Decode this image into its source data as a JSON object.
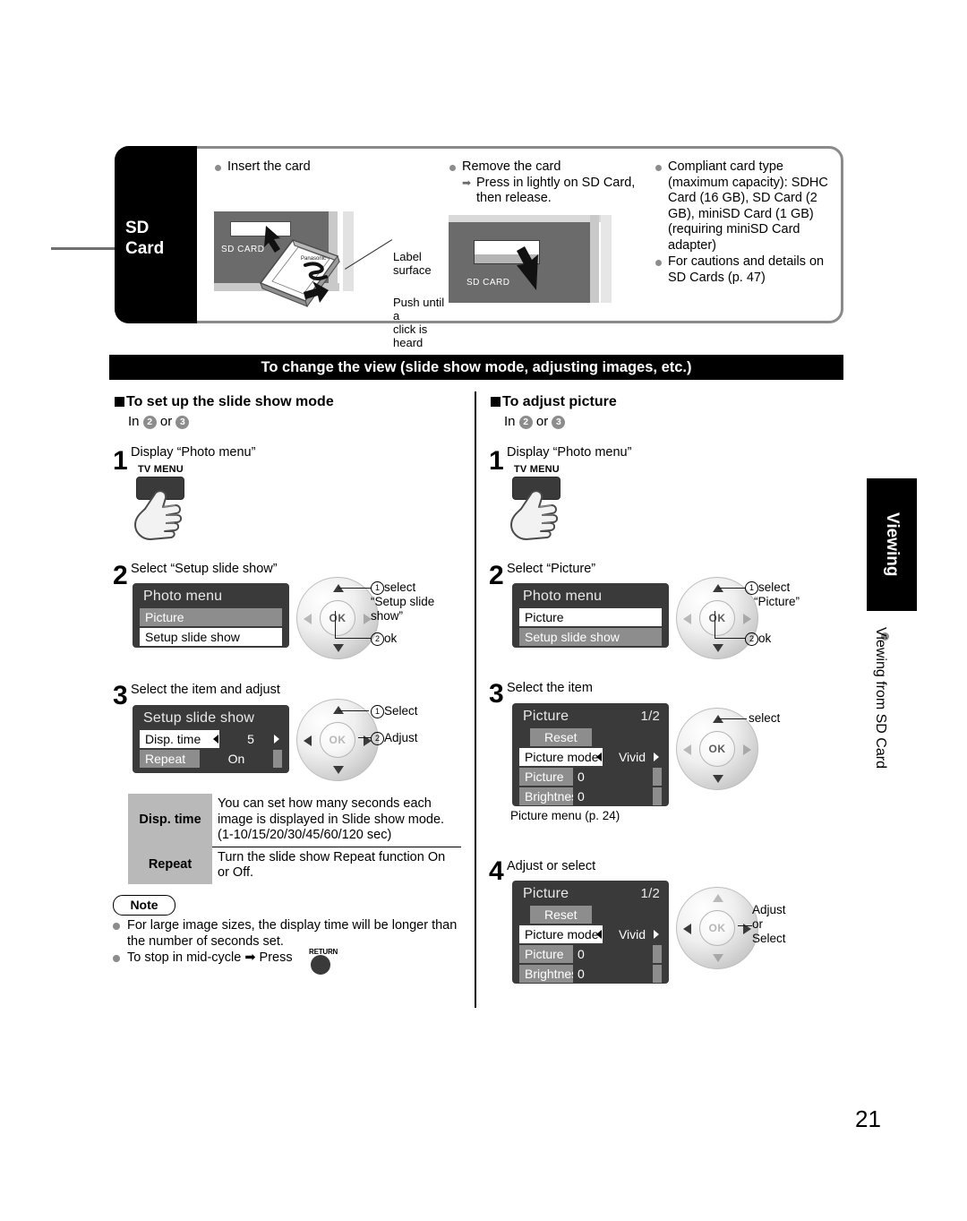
{
  "sd_box": {
    "tab_label_line1": "SD",
    "tab_label_line2": "Card",
    "insert": {
      "heading": "Insert the card",
      "callout_label": "Label\nsurface",
      "callout_push": "Push until a\nclick is heard",
      "slot_text": "SD CARD"
    },
    "remove": {
      "heading": "Remove the card",
      "detail": "Press in lightly on SD Card, then release.",
      "slot_text": "SD CARD"
    },
    "compliant": {
      "heading": "Compliant card type (maximum capacity): SDHC Card (16 GB), SD Card (2 GB), miniSD Card (1 GB) (requiring miniSD Card adapter)",
      "second": "For cautions and details on SD Cards (p. 47)"
    }
  },
  "banner": {
    "title": "To change the view (slide show mode, adjusting images, etc.)"
  },
  "left_column": {
    "heading": "To set up the slide show mode",
    "in_prefix": "In",
    "in_num1": "2",
    "in_or": "or",
    "in_num2": "3",
    "step1": {
      "num": "1",
      "text": "Display “Photo menu”",
      "button_label": "TV MENU"
    },
    "step2": {
      "num": "2",
      "text": "Select “Setup slide show”",
      "menu": {
        "title": "Photo menu",
        "rows": [
          {
            "label": "Picture",
            "selected": false
          },
          {
            "label": "Setup slide show",
            "selected": true
          }
        ]
      },
      "dpad": {
        "note1_num": "1",
        "note1": "select",
        "note1_extra": "“Setup slide show”",
        "note2_num": "2",
        "note2": "ok",
        "ok_label": "OK"
      }
    },
    "step3": {
      "num": "3",
      "text": "Select the item and adjust",
      "menu": {
        "title": "Setup slide show",
        "rows": [
          {
            "label": "Disp. time",
            "value": "5",
            "selected": true
          },
          {
            "label": "Repeat",
            "value": "On",
            "selected": false
          }
        ]
      },
      "dpad": {
        "note1_num": "1",
        "note1": "Select",
        "note2_num": "2",
        "note2": "Adjust",
        "ok_label": "OK"
      }
    },
    "table": {
      "rows": [
        {
          "key": "Disp. time",
          "value": "You can set how many seconds each image is displayed in Slide show mode. (1-10/15/20/30/45/60/120 sec)"
        },
        {
          "key": "Repeat",
          "value": "Turn the slide show Repeat function On or Off."
        }
      ]
    },
    "note": {
      "badge": "Note",
      "items": [
        "For large image sizes, the display time will be longer than the number of seconds set.",
        "To stop in mid-cycle ➡ Press"
      ],
      "return_label": "RETURN"
    }
  },
  "right_column": {
    "heading": "To adjust picture",
    "in_prefix": "In",
    "in_num1": "2",
    "in_or": "or",
    "in_num2": "3",
    "step1": {
      "num": "1",
      "text": "Display “Photo menu”",
      "button_label": "TV MENU"
    },
    "step2": {
      "num": "2",
      "text": "Select “Picture”",
      "menu": {
        "title": "Photo menu",
        "rows": [
          {
            "label": "Picture",
            "selected": true
          },
          {
            "label": "Setup slide show",
            "selected": false
          }
        ]
      },
      "dpad": {
        "note1_num": "1",
        "note1": "select",
        "note1_extra": "“Picture”",
        "note2_num": "2",
        "note2": "ok",
        "ok_label": "OK"
      }
    },
    "step3": {
      "num": "3",
      "text": "Select the item",
      "menu": {
        "title": "Picture",
        "page": "1/2",
        "reset_label": "Reset",
        "rows": [
          {
            "label": "Picture mode",
            "value": "Vivid",
            "selected": true
          },
          {
            "label": "Picture",
            "value": "0",
            "selected": false
          },
          {
            "label": "Brightness",
            "value": "0",
            "selected": false
          }
        ]
      },
      "caption": "Picture menu (p. 24)",
      "dpad": {
        "note1": "select",
        "ok_label": "OK"
      }
    },
    "step4": {
      "num": "4",
      "text": "Adjust or select",
      "menu": {
        "title": "Picture",
        "page": "1/2",
        "reset_label": "Reset",
        "rows": [
          {
            "label": "Picture mode",
            "value": "Vivid",
            "selected": true
          },
          {
            "label": "Picture",
            "value": "0",
            "selected": false
          },
          {
            "label": "Brightness",
            "value": "0",
            "selected": false
          }
        ]
      },
      "dpad": {
        "note1": "Adjust\nor\nSelect",
        "ok_label": "OK"
      }
    }
  },
  "side_tab": {
    "title": "Viewing",
    "subtitle": "Viewing from SD Card"
  },
  "page_number": "21"
}
